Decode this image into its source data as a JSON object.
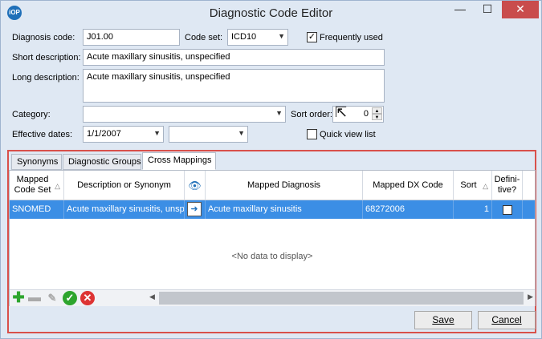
{
  "window": {
    "title": "Diagnostic Code Editor",
    "icon_text": "iOP",
    "minimize_glyph": "—",
    "maximize_glyph": "☐",
    "close_glyph": "✕"
  },
  "form": {
    "diagnosis_code_label": "Diagnosis code:",
    "diagnosis_code_value": "J01.00",
    "code_set_label": "Code set:",
    "code_set_value": "ICD10",
    "frequently_used_label": "Frequently used",
    "frequently_used_checked": true,
    "short_description_label": "Short description:",
    "short_description_value": "Acute maxillary sinusitis, unspecified",
    "long_description_label": "Long description:",
    "long_description_value": "Acute maxillary sinusitis, unspecified",
    "category_label": "Category:",
    "category_value": "",
    "sort_order_label": "Sort order:",
    "sort_order_value": "0",
    "effective_dates_label": "Effective dates:",
    "effective_start_value": "1/1/2007",
    "effective_end_value": "",
    "quick_view_label": "Quick view list",
    "quick_view_checked": false
  },
  "tabs": [
    {
      "label": "Synonyms"
    },
    {
      "label": "Diagnostic Groups"
    },
    {
      "label": "Cross Mappings",
      "active": true
    }
  ],
  "grid": {
    "columns": [
      {
        "label": "Mapped Code Set"
      },
      {
        "label": "Description or Synonym"
      },
      {
        "label": ""
      },
      {
        "label": "Mapped Diagnosis"
      },
      {
        "label": "Mapped DX Code"
      },
      {
        "label": "Sort"
      },
      {
        "label": "Defini-tive?"
      }
    ],
    "rows": [
      {
        "mapped_code_set": "SNOMED",
        "description": "Acute maxillary sinusitis, unspecified",
        "mapped_diagnosis": "Acute maxillary sinusitis",
        "mapped_dx_code": "68272006",
        "sort": "1",
        "definitive": false
      }
    ],
    "empty_text": "<No data to display>"
  },
  "toolbar_icons": [
    "add-icon",
    "remove-icon",
    "edit-icon",
    "accept-icon",
    "cancel-icon"
  ],
  "buttons": {
    "save": "Save",
    "cancel": "Cancel"
  },
  "colors": {
    "selected_row": "#3b8ee5",
    "highlight_border": "#d9504a"
  }
}
